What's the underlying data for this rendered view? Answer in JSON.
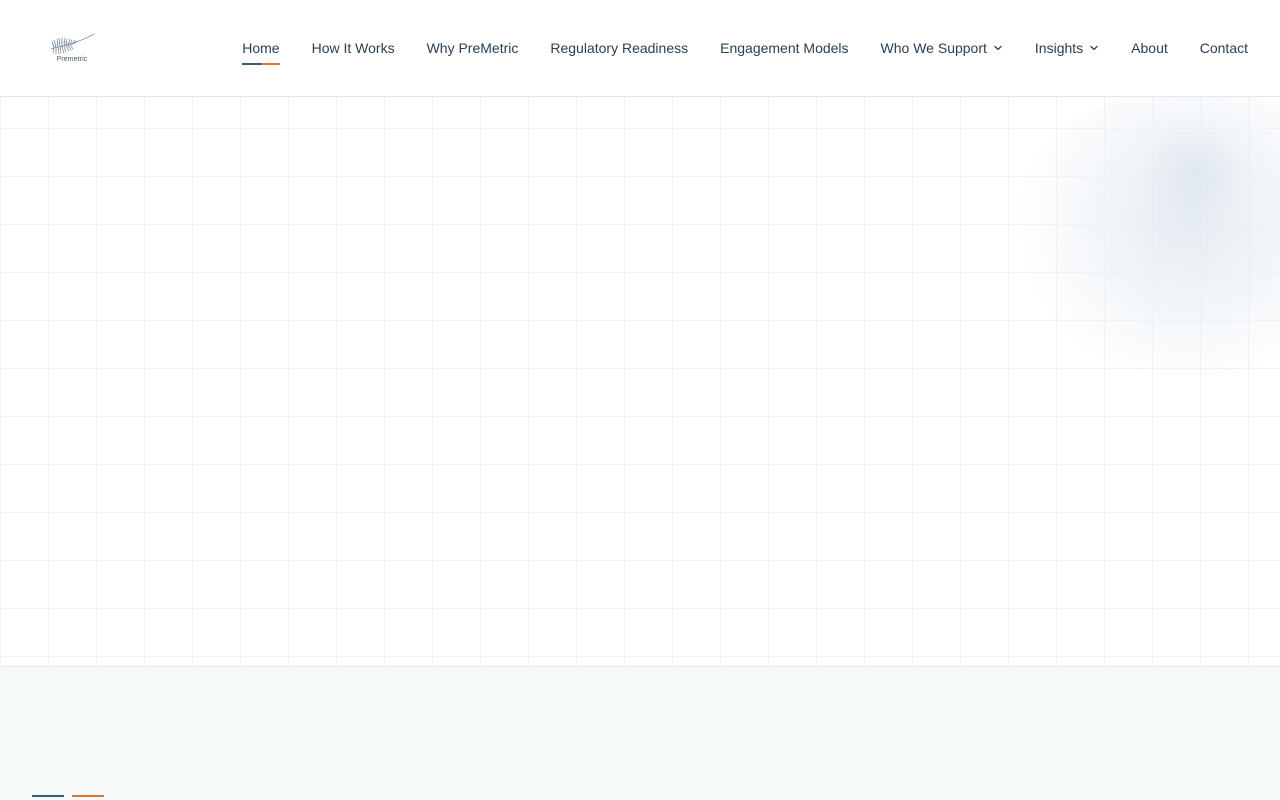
{
  "logo": {
    "text": "Premetric"
  },
  "nav": {
    "items": [
      {
        "label": "Home",
        "active": true,
        "has_dropdown": false
      },
      {
        "label": "How It Works",
        "active": false,
        "has_dropdown": false
      },
      {
        "label": "Why PreMetric",
        "active": false,
        "has_dropdown": false
      },
      {
        "label": "Regulatory Readiness",
        "active": false,
        "has_dropdown": false
      },
      {
        "label": "Engagement Models",
        "active": false,
        "has_dropdown": false
      },
      {
        "label": "Who We Support",
        "active": false,
        "has_dropdown": true
      },
      {
        "label": "Insights",
        "active": false,
        "has_dropdown": true
      },
      {
        "label": "About",
        "active": false,
        "has_dropdown": false
      },
      {
        "label": "Contact",
        "active": false,
        "has_dropdown": false
      }
    ]
  },
  "colors": {
    "nav_text": "#2a3f55",
    "accent_primary": "#3e5a78",
    "accent_secondary": "#e0752f",
    "section_bg": "#f6f9fa",
    "grid_line": "#eef2f5"
  },
  "icons": {
    "logo": "feather-logo-icon",
    "dropdown": "chevron-down-icon"
  }
}
